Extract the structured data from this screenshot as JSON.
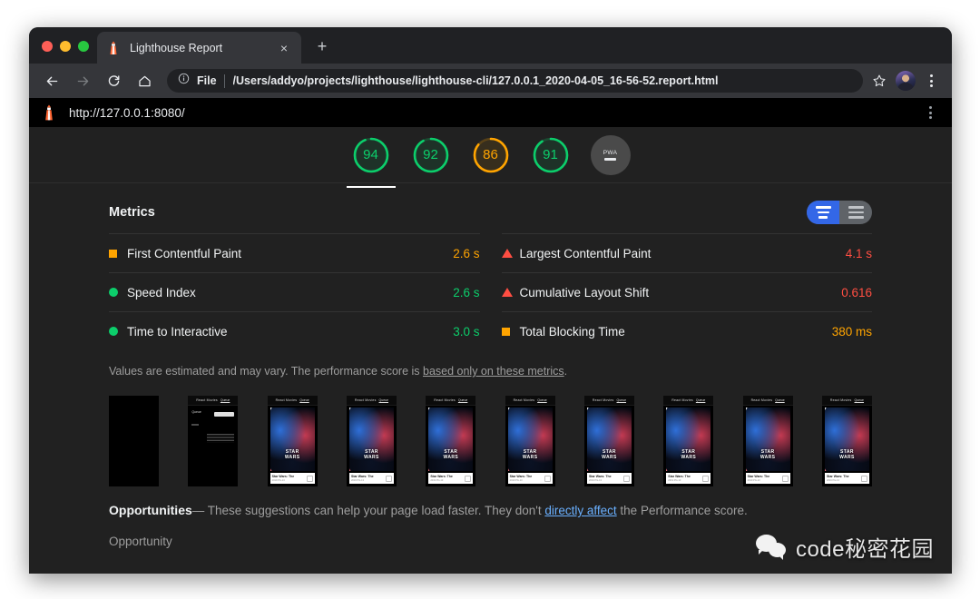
{
  "browser": {
    "tab": {
      "title": "Lighthouse Report",
      "favicon": "lighthouse-icon",
      "close": "×"
    },
    "new_tab": "+",
    "nav": {
      "back": "←",
      "forward": "→",
      "reload": "↻",
      "home": "⌂"
    },
    "omnibox": {
      "scheme_label": "File",
      "url": "/Users/addyo/projects/lighthouse/lighthouse-cli/127.0.0.1_2020-04-05_16-56-52.report.html",
      "info_icon": "info-icon"
    },
    "star_icon": "star-icon",
    "avatar": "profile-avatar",
    "menu_icon": "three-dot-menu-icon"
  },
  "lighthouse_header": {
    "icon": "lighthouse-icon",
    "url": "http://127.0.0.1:8080/",
    "menu_icon": "three-dot-menu-icon"
  },
  "gauges": [
    {
      "name": "performance",
      "score": "94",
      "color": "#0cce6b",
      "selected": true
    },
    {
      "name": "accessibility",
      "score": "92",
      "color": "#0cce6b",
      "selected": false
    },
    {
      "name": "best-practices",
      "score": "86",
      "color": "#ffa400",
      "selected": false
    },
    {
      "name": "seo",
      "score": "91",
      "color": "#0cce6b",
      "selected": false
    },
    {
      "name": "pwa",
      "score": "—",
      "label": "PWA",
      "color": "#4a4a4a",
      "selected": false
    }
  ],
  "metrics": {
    "title": "Metrics",
    "toggle": {
      "expand_label": "expand-view",
      "collapse_label": "list-view",
      "active": "expand"
    },
    "left": [
      {
        "label": "First Contentful Paint",
        "value": "2.6 s",
        "marker": "square",
        "status": "avg"
      },
      {
        "label": "Speed Index",
        "value": "2.6 s",
        "marker": "circle",
        "status": "pass"
      },
      {
        "label": "Time to Interactive",
        "value": "3.0 s",
        "marker": "circle",
        "status": "pass"
      }
    ],
    "right": [
      {
        "label": "Largest Contentful Paint",
        "value": "4.1 s",
        "marker": "triangle",
        "status": "fail"
      },
      {
        "label": "Cumulative Layout Shift",
        "value": "0.616",
        "marker": "triangle",
        "status": "fail"
      },
      {
        "label": "Total Blocking Time",
        "value": "380 ms",
        "marker": "square",
        "status": "avg"
      }
    ],
    "disclaimer_pre": "Values are estimated and may vary. The performance score is ",
    "disclaimer_link": "based only on these metrics",
    "disclaimer_post": "."
  },
  "filmstrip": {
    "frames": [
      {
        "state": "blank"
      },
      {
        "state": "loading",
        "header_left": "React Movies",
        "header_right": "Queue",
        "section": "Queue",
        "pill": "",
        "note": "To get started, follow on Learn more about configuring React."
      },
      {
        "state": "loaded"
      },
      {
        "state": "loaded"
      },
      {
        "state": "loaded"
      },
      {
        "state": "loaded"
      },
      {
        "state": "loaded"
      },
      {
        "state": "loaded"
      },
      {
        "state": "loaded"
      },
      {
        "state": "loaded"
      }
    ],
    "page": {
      "header_left": "React Movies",
      "header_right": "Queue",
      "poster_title": "STAR WARS",
      "card_title": "Star Wars: The",
      "card_sub": "2019 PG-13"
    }
  },
  "opportunities": {
    "title": "Opportunities",
    "dash": "—",
    "text_pre": " These suggestions can help your page load faster. They don't ",
    "link": "directly affect",
    "text_post": " the Performance score.",
    "column_header": "Opportunity"
  },
  "watermark": {
    "text": "code秘密花园",
    "icon": "wechat-icon"
  }
}
